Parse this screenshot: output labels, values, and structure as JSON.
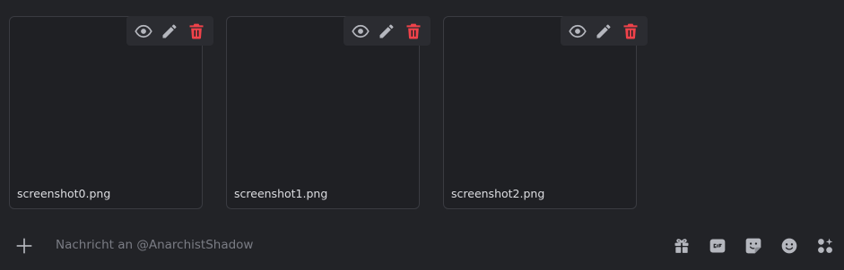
{
  "attachments": [
    {
      "filename": "screenshot0.png"
    },
    {
      "filename": "screenshot1.png"
    },
    {
      "filename": "screenshot2.png"
    }
  ],
  "attachment_actions": {
    "icons": [
      "eye-icon",
      "pencil-icon",
      "trash-icon"
    ]
  },
  "composer": {
    "placeholder": "Nachricht an @AnarchistShadow",
    "value": "",
    "icons": [
      "plus-icon",
      "gift-icon",
      "gif-icon",
      "sticker-icon",
      "emoji-icon",
      "apps-icon"
    ]
  },
  "colors": {
    "background": "#222327",
    "card_border": "#3a3b41",
    "toolbar": "#2b2c31",
    "icon": "#b5b7be",
    "danger": "#f0424a"
  }
}
